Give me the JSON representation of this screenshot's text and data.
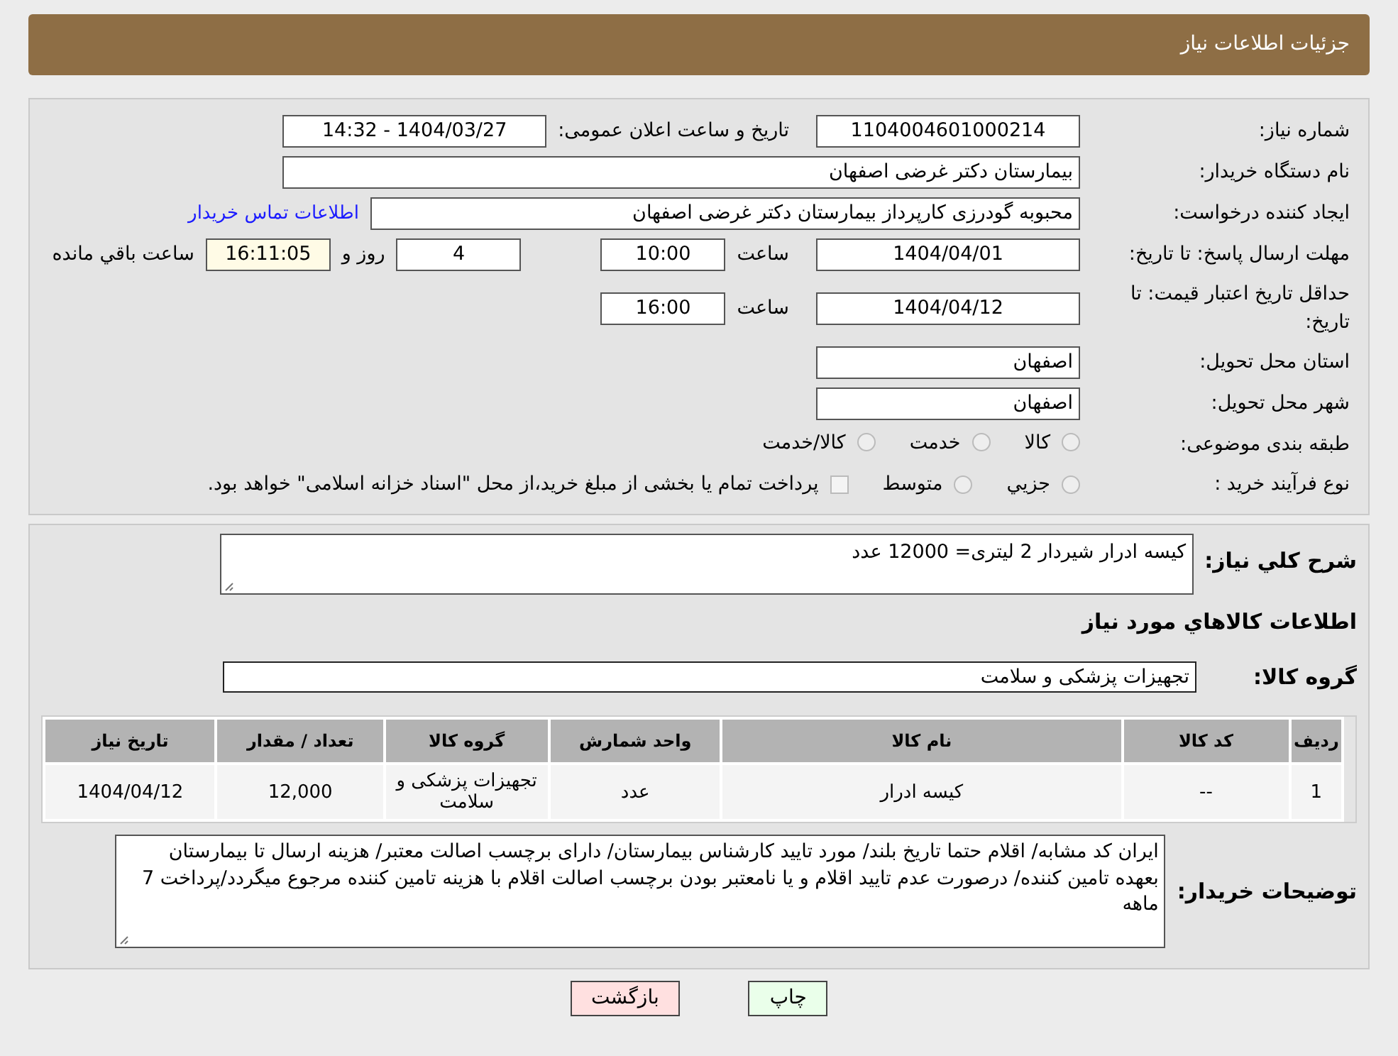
{
  "header": {
    "title": "جزئیات اطلاعات نیاز"
  },
  "need_number": {
    "label": "شماره نیاز:",
    "value": "1104004601000214"
  },
  "announce": {
    "label": "تاریخ و ساعت اعلان عمومی:",
    "value": "1404/03/27 - 14:32"
  },
  "buyer_org": {
    "label": "نام دستگاه خریدار:",
    "value": "بیمارستان دکتر غرضی اصفهان"
  },
  "requester": {
    "label": "ایجاد کننده درخواست:",
    "value": "محبوبه گودرزی کارپرداز بیمارستان دکتر غرضی اصفهان",
    "link": "اطلاعات تماس خریدار"
  },
  "deadline": {
    "label": "مهلت ارسال پاسخ: تا تاریخ:",
    "date": "1404/04/01",
    "time_label": "ساعت",
    "time": "10:00",
    "days": "4",
    "days_label": "روز و",
    "remaining": "16:11:05",
    "remaining_label": "ساعت باقي مانده"
  },
  "price_validity": {
    "label": "حداقل تاریخ اعتبار قیمت: تا تاریخ:",
    "date": "1404/04/12",
    "time_label": "ساعت",
    "time": "16:00"
  },
  "province": {
    "label": "استان محل تحویل:",
    "value": "اصفهان"
  },
  "city": {
    "label": "شهر محل تحویل:",
    "value": "اصفهان"
  },
  "category": {
    "label": "طبقه بندی موضوعی:",
    "options": [
      {
        "label": "کالا",
        "selected": false
      },
      {
        "label": "خدمت",
        "selected": false
      },
      {
        "label": "کالا/خدمت",
        "selected": false
      }
    ]
  },
  "purchase_type": {
    "label": "نوع فرآیند خرید :",
    "options": [
      {
        "label": "جزيي",
        "selected": false
      },
      {
        "label": "متوسط",
        "selected": false
      }
    ],
    "payment_note": {
      "label": "پرداخت تمام یا بخشی از مبلغ خرید،از محل \"اسناد خزانه اسلامی\" خواهد بود.",
      "checked": false
    }
  },
  "description": {
    "label": "شرح کلي نیاز:",
    "value": "کیسه ادرار شیردار 2 لیتری= 12000 عدد"
  },
  "goods_section": {
    "title": "اطلاعات کالاهاي مورد نیاز"
  },
  "goods_group": {
    "label": "گروه کالا:",
    "value": "تجهیزات پزشکی و سلامت"
  },
  "table": {
    "columns": [
      "ردیف",
      "کد کالا",
      "نام کالا",
      "واحد شمارش",
      "گروه کالا",
      "تعداد / مقدار",
      "تاریخ نیاز"
    ],
    "rows": [
      [
        "1",
        "--",
        "کیسه ادرار",
        "عدد",
        "تجهیزات پزشکی و سلامت",
        "12,000",
        "1404/04/12"
      ]
    ]
  },
  "buyer_notes": {
    "label": "توضیحات خریدار:",
    "value": "ایران کد مشابه/ اقلام حتما تاریخ بلند/ مورد تایید کارشناس بیمارستان/ دارای برچسب اصالت معتبر/ هزینه ارسال تا بیمارستان بعهده تامین کننده/ درصورت عدم تایید اقلام و یا نامعتبر بودن برچسب اصالت اقلام با هزینه تامین کننده مرجوع میگردد/پرداخت 7 ماهه"
  },
  "buttons": [
    {
      "label": "چاپ",
      "kind": "print"
    },
    {
      "label": "بازگشت",
      "kind": "back"
    }
  ]
}
